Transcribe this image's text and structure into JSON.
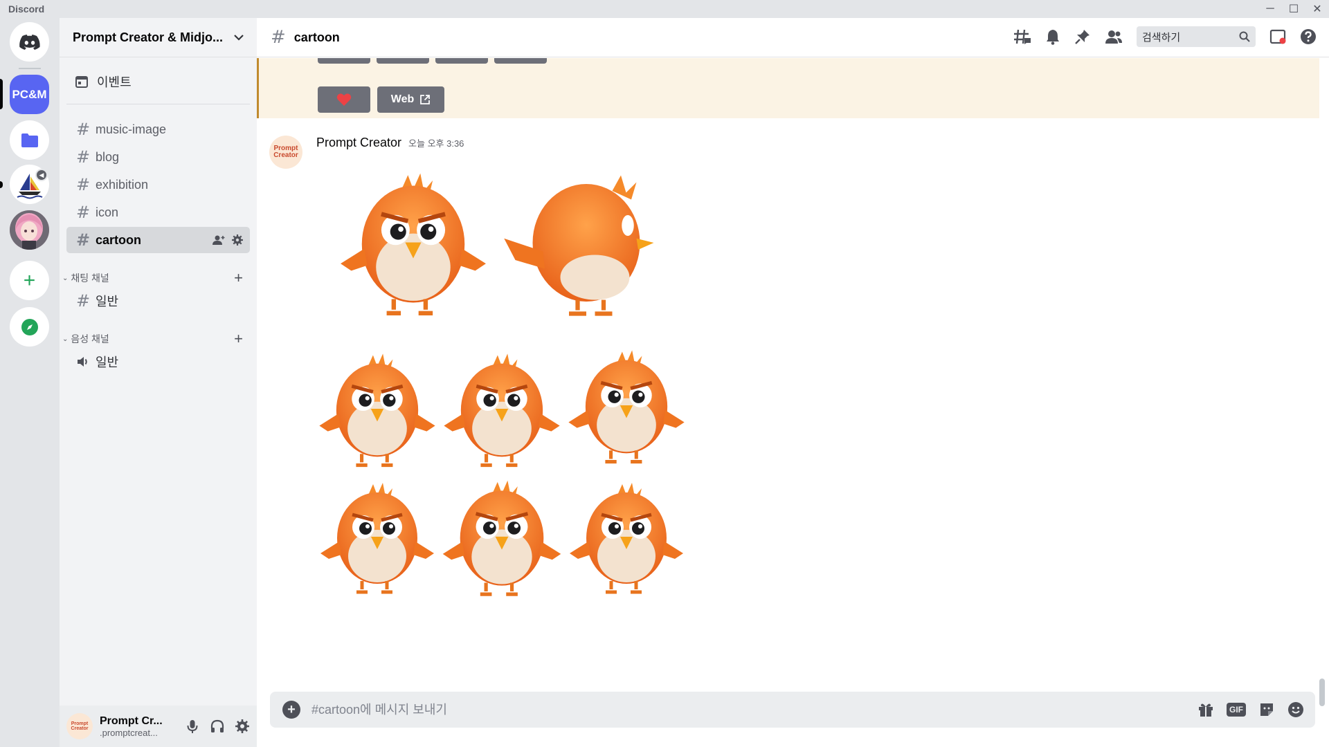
{
  "window": {
    "app_name": "Discord",
    "controls": [
      "─",
      "☐",
      "✕"
    ]
  },
  "server_rail": {
    "home_icon": "discord-logo-icon",
    "servers": [
      {
        "label": "PC&M",
        "selected": true
      },
      {
        "label": "folder"
      },
      {
        "label": "sailboat-server"
      },
      {
        "label": "anime-avatar-server"
      }
    ],
    "add_server": "+",
    "explore": "compass"
  },
  "sidebar": {
    "guild_name": "Prompt Creator & Midjo...",
    "events_label": "이벤트",
    "channels": [
      {
        "name": "music-image"
      },
      {
        "name": "blog"
      },
      {
        "name": "exhibition"
      },
      {
        "name": "icon"
      },
      {
        "name": "cartoon",
        "active": true
      }
    ],
    "categories": [
      {
        "name": "채팅 채널",
        "channels": [
          {
            "name": "일반"
          }
        ]
      },
      {
        "name": "음성 채널",
        "channels": [
          {
            "name": "일반"
          }
        ]
      }
    ]
  },
  "user_panel": {
    "avatar_text": "Prompt Creator",
    "name": "Prompt Cr...",
    "sub": ".promptcreat..."
  },
  "header": {
    "channel": "cartoon",
    "search_placeholder": "검색하기"
  },
  "highlight_message": {
    "buttons": [
      {
        "label": "",
        "icon": "heart-icon"
      },
      {
        "label": "Web",
        "icon": "external-link-icon"
      }
    ]
  },
  "message": {
    "avatar_text": "Prompt Creator",
    "author": "Prompt Creator",
    "timestamp": "오늘 오후 3:36",
    "attachment": "9 cartoon orange bird character poses"
  },
  "composer": {
    "placeholder": "#cartoon에 메시지 보내기"
  },
  "colors": {
    "accent": "#5865f2",
    "bird_orange": "#f07a1e",
    "bird_belly": "#f4e4d2",
    "heart": "#ed4245"
  }
}
